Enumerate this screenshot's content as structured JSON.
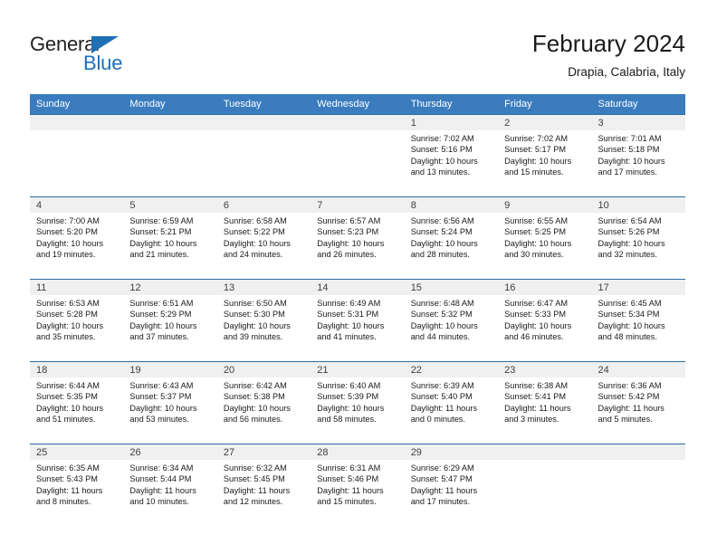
{
  "brand": {
    "name_top": "General",
    "name_bottom": "Blue",
    "triangle_icon": "blue-triangle-icon",
    "accent_color": "#1f6fb5"
  },
  "header": {
    "title": "February 2024",
    "subtitle": "Drapia, Calabria, Italy"
  },
  "calendar": {
    "header_bg": "#3a7cbe",
    "row_border_color": "#2e6da4",
    "daynum_band_bg": "#f0f0f0",
    "weekdays": [
      "Sunday",
      "Monday",
      "Tuesday",
      "Wednesday",
      "Thursday",
      "Friday",
      "Saturday"
    ],
    "weeks": [
      [
        {
          "day": "",
          "lines": []
        },
        {
          "day": "",
          "lines": []
        },
        {
          "day": "",
          "lines": []
        },
        {
          "day": "",
          "lines": []
        },
        {
          "day": "1",
          "lines": [
            "Sunrise: 7:02 AM",
            "Sunset: 5:16 PM",
            "Daylight: 10 hours",
            "and 13 minutes."
          ]
        },
        {
          "day": "2",
          "lines": [
            "Sunrise: 7:02 AM",
            "Sunset: 5:17 PM",
            "Daylight: 10 hours",
            "and 15 minutes."
          ]
        },
        {
          "day": "3",
          "lines": [
            "Sunrise: 7:01 AM",
            "Sunset: 5:18 PM",
            "Daylight: 10 hours",
            "and 17 minutes."
          ]
        }
      ],
      [
        {
          "day": "4",
          "lines": [
            "Sunrise: 7:00 AM",
            "Sunset: 5:20 PM",
            "Daylight: 10 hours",
            "and 19 minutes."
          ]
        },
        {
          "day": "5",
          "lines": [
            "Sunrise: 6:59 AM",
            "Sunset: 5:21 PM",
            "Daylight: 10 hours",
            "and 21 minutes."
          ]
        },
        {
          "day": "6",
          "lines": [
            "Sunrise: 6:58 AM",
            "Sunset: 5:22 PM",
            "Daylight: 10 hours",
            "and 24 minutes."
          ]
        },
        {
          "day": "7",
          "lines": [
            "Sunrise: 6:57 AM",
            "Sunset: 5:23 PM",
            "Daylight: 10 hours",
            "and 26 minutes."
          ]
        },
        {
          "day": "8",
          "lines": [
            "Sunrise: 6:56 AM",
            "Sunset: 5:24 PM",
            "Daylight: 10 hours",
            "and 28 minutes."
          ]
        },
        {
          "day": "9",
          "lines": [
            "Sunrise: 6:55 AM",
            "Sunset: 5:25 PM",
            "Daylight: 10 hours",
            "and 30 minutes."
          ]
        },
        {
          "day": "10",
          "lines": [
            "Sunrise: 6:54 AM",
            "Sunset: 5:26 PM",
            "Daylight: 10 hours",
            "and 32 minutes."
          ]
        }
      ],
      [
        {
          "day": "11",
          "lines": [
            "Sunrise: 6:53 AM",
            "Sunset: 5:28 PM",
            "Daylight: 10 hours",
            "and 35 minutes."
          ]
        },
        {
          "day": "12",
          "lines": [
            "Sunrise: 6:51 AM",
            "Sunset: 5:29 PM",
            "Daylight: 10 hours",
            "and 37 minutes."
          ]
        },
        {
          "day": "13",
          "lines": [
            "Sunrise: 6:50 AM",
            "Sunset: 5:30 PM",
            "Daylight: 10 hours",
            "and 39 minutes."
          ]
        },
        {
          "day": "14",
          "lines": [
            "Sunrise: 6:49 AM",
            "Sunset: 5:31 PM",
            "Daylight: 10 hours",
            "and 41 minutes."
          ]
        },
        {
          "day": "15",
          "lines": [
            "Sunrise: 6:48 AM",
            "Sunset: 5:32 PM",
            "Daylight: 10 hours",
            "and 44 minutes."
          ]
        },
        {
          "day": "16",
          "lines": [
            "Sunrise: 6:47 AM",
            "Sunset: 5:33 PM",
            "Daylight: 10 hours",
            "and 46 minutes."
          ]
        },
        {
          "day": "17",
          "lines": [
            "Sunrise: 6:45 AM",
            "Sunset: 5:34 PM",
            "Daylight: 10 hours",
            "and 48 minutes."
          ]
        }
      ],
      [
        {
          "day": "18",
          "lines": [
            "Sunrise: 6:44 AM",
            "Sunset: 5:35 PM",
            "Daylight: 10 hours",
            "and 51 minutes."
          ]
        },
        {
          "day": "19",
          "lines": [
            "Sunrise: 6:43 AM",
            "Sunset: 5:37 PM",
            "Daylight: 10 hours",
            "and 53 minutes."
          ]
        },
        {
          "day": "20",
          "lines": [
            "Sunrise: 6:42 AM",
            "Sunset: 5:38 PM",
            "Daylight: 10 hours",
            "and 56 minutes."
          ]
        },
        {
          "day": "21",
          "lines": [
            "Sunrise: 6:40 AM",
            "Sunset: 5:39 PM",
            "Daylight: 10 hours",
            "and 58 minutes."
          ]
        },
        {
          "day": "22",
          "lines": [
            "Sunrise: 6:39 AM",
            "Sunset: 5:40 PM",
            "Daylight: 11 hours",
            "and 0 minutes."
          ]
        },
        {
          "day": "23",
          "lines": [
            "Sunrise: 6:38 AM",
            "Sunset: 5:41 PM",
            "Daylight: 11 hours",
            "and 3 minutes."
          ]
        },
        {
          "day": "24",
          "lines": [
            "Sunrise: 6:36 AM",
            "Sunset: 5:42 PM",
            "Daylight: 11 hours",
            "and 5 minutes."
          ]
        }
      ],
      [
        {
          "day": "25",
          "lines": [
            "Sunrise: 6:35 AM",
            "Sunset: 5:43 PM",
            "Daylight: 11 hours",
            "and 8 minutes."
          ]
        },
        {
          "day": "26",
          "lines": [
            "Sunrise: 6:34 AM",
            "Sunset: 5:44 PM",
            "Daylight: 11 hours",
            "and 10 minutes."
          ]
        },
        {
          "day": "27",
          "lines": [
            "Sunrise: 6:32 AM",
            "Sunset: 5:45 PM",
            "Daylight: 11 hours",
            "and 12 minutes."
          ]
        },
        {
          "day": "28",
          "lines": [
            "Sunrise: 6:31 AM",
            "Sunset: 5:46 PM",
            "Daylight: 11 hours",
            "and 15 minutes."
          ]
        },
        {
          "day": "29",
          "lines": [
            "Sunrise: 6:29 AM",
            "Sunset: 5:47 PM",
            "Daylight: 11 hours",
            "and 17 minutes."
          ]
        },
        {
          "day": "",
          "lines": []
        },
        {
          "day": "",
          "lines": []
        }
      ]
    ]
  }
}
